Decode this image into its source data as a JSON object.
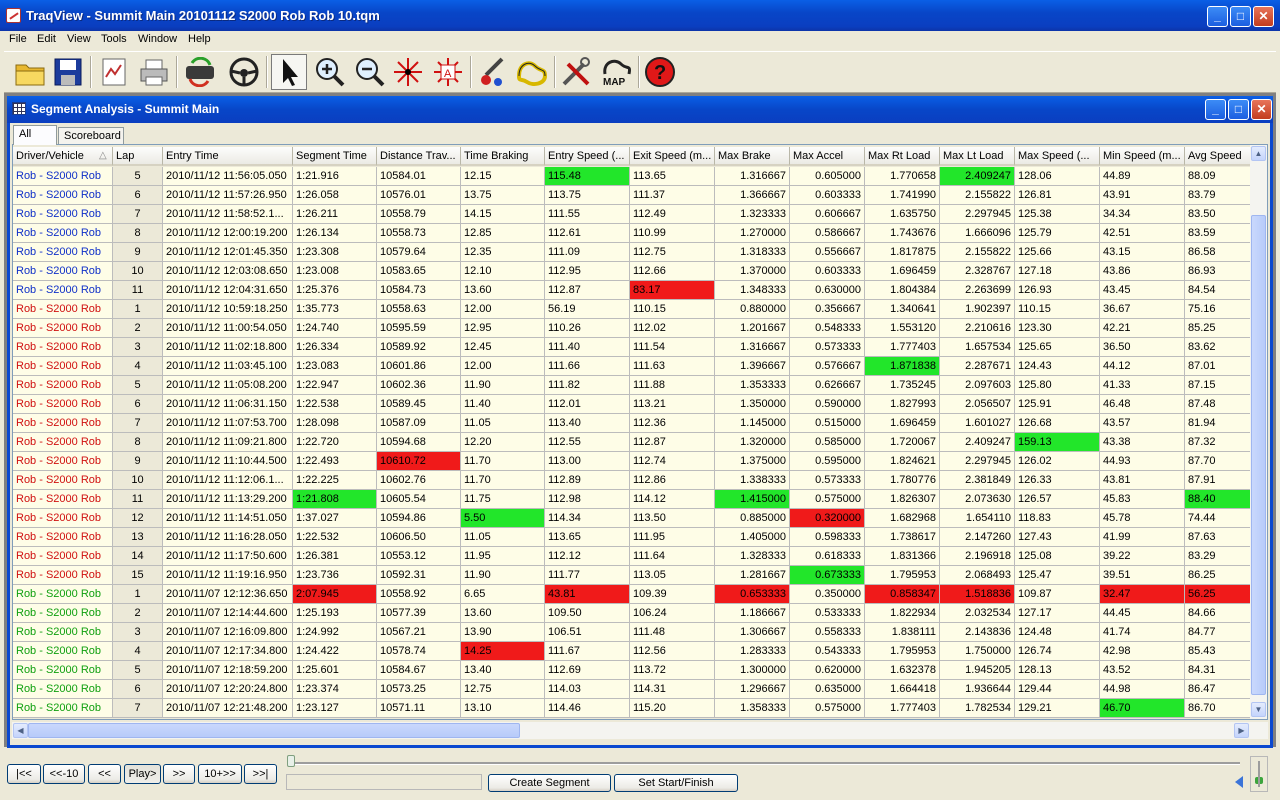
{
  "window": {
    "title": "TraqView - Summit Main 20101112 S2000 Rob Rob 10.tqm"
  },
  "menu": [
    "File",
    "Edit",
    "View",
    "Tools",
    "Window",
    "Help"
  ],
  "toolbar_icons": [
    "open-folder-icon",
    "save-icon",
    "report-icon",
    "print-icon",
    "sync-icon",
    "steering-wheel-icon",
    "pointer-icon",
    "zoom-in-icon",
    "zoom-out-icon",
    "crosshair-icon",
    "target-icon",
    "paint-icon",
    "track-icon",
    "tools-icon",
    "map-icon",
    "help-icon"
  ],
  "toolbar_map_label": "MAP",
  "toolbar_help_label": "?",
  "child": {
    "title": "Segment Analysis - Summit Main"
  },
  "tabs": [
    "All",
    "Scoreboard"
  ],
  "columns": [
    "Driver/Vehicle",
    "Lap",
    "Entry Time",
    "Segment Time",
    "Distance Trav...",
    "Time Braking",
    "Entry Speed (...",
    "Exit Speed (m...",
    "Max Brake",
    "Max Accel",
    "Max Rt Load",
    "Max Lt Load",
    "Max Speed (...",
    "Min Speed (m...",
    "Avg Speed"
  ],
  "colors": {
    "blue_driver": "#1030c8",
    "red_driver": "#d01010",
    "green_driver": "#10a010",
    "highlight_green": "#22e62a",
    "highlight_red": "#f01a1a"
  },
  "rows": [
    {
      "g": "blue",
      "d": [
        "Rob - S2000 Rob",
        "5",
        "2010/11/12 11:56:05.050",
        "1:21.916",
        "10584.01",
        "12.15",
        "115.48",
        "113.65",
        "1.316667",
        "0.605000",
        "1.770658",
        "2.409247",
        "128.06",
        "44.89",
        "88.09"
      ],
      "hl": {
        "6": "green",
        "11": "green"
      }
    },
    {
      "g": "blue",
      "d": [
        "Rob - S2000 Rob",
        "6",
        "2010/11/12 11:57:26.950",
        "1:26.058",
        "10576.01",
        "13.75",
        "113.75",
        "111.37",
        "1.366667",
        "0.603333",
        "1.741990",
        "2.155822",
        "126.81",
        "43.91",
        "83.79"
      ],
      "hl": {}
    },
    {
      "g": "blue",
      "d": [
        "Rob - S2000 Rob",
        "7",
        "2010/11/12 11:58:52.1...",
        "1:26.211",
        "10558.79",
        "14.15",
        "111.55",
        "112.49",
        "1.323333",
        "0.606667",
        "1.635750",
        "2.297945",
        "125.38",
        "34.34",
        "83.50"
      ],
      "hl": {}
    },
    {
      "g": "blue",
      "d": [
        "Rob - S2000 Rob",
        "8",
        "2010/11/12 12:00:19.200",
        "1:26.134",
        "10558.73",
        "12.85",
        "112.61",
        "110.99",
        "1.270000",
        "0.586667",
        "1.743676",
        "1.666096",
        "125.79",
        "42.51",
        "83.59"
      ],
      "hl": {}
    },
    {
      "g": "blue",
      "d": [
        "Rob - S2000 Rob",
        "9",
        "2010/11/12 12:01:45.350",
        "1:23.308",
        "10579.64",
        "12.35",
        "111.09",
        "112.75",
        "1.318333",
        "0.556667",
        "1.817875",
        "2.155822",
        "125.66",
        "43.15",
        "86.58"
      ],
      "hl": {}
    },
    {
      "g": "blue",
      "d": [
        "Rob - S2000 Rob",
        "10",
        "2010/11/12 12:03:08.650",
        "1:23.008",
        "10583.65",
        "12.10",
        "112.95",
        "112.66",
        "1.370000",
        "0.603333",
        "1.696459",
        "2.328767",
        "127.18",
        "43.86",
        "86.93"
      ],
      "hl": {}
    },
    {
      "g": "blue",
      "d": [
        "Rob - S2000 Rob",
        "11",
        "2010/11/12 12:04:31.650",
        "1:25.376",
        "10584.73",
        "13.60",
        "112.87",
        "83.17",
        "1.348333",
        "0.630000",
        "1.804384",
        "2.263699",
        "126.93",
        "43.45",
        "84.54"
      ],
      "hl": {
        "7": "red"
      }
    },
    {
      "g": "red",
      "d": [
        "Rob - S2000 Rob",
        "1",
        "2010/11/12 10:59:18.250",
        "1:35.773",
        "10558.63",
        "12.00",
        "56.19",
        "110.15",
        "0.880000",
        "0.356667",
        "1.340641",
        "1.902397",
        "110.15",
        "36.67",
        "75.16"
      ],
      "hl": {}
    },
    {
      "g": "red",
      "d": [
        "Rob - S2000 Rob",
        "2",
        "2010/11/12 11:00:54.050",
        "1:24.740",
        "10595.59",
        "12.95",
        "110.26",
        "112.02",
        "1.201667",
        "0.548333",
        "1.553120",
        "2.210616",
        "123.30",
        "42.21",
        "85.25"
      ],
      "hl": {}
    },
    {
      "g": "red",
      "d": [
        "Rob - S2000 Rob",
        "3",
        "2010/11/12 11:02:18.800",
        "1:26.334",
        "10589.92",
        "12.45",
        "111.40",
        "111.54",
        "1.316667",
        "0.573333",
        "1.777403",
        "1.657534",
        "125.65",
        "36.50",
        "83.62"
      ],
      "hl": {}
    },
    {
      "g": "red",
      "d": [
        "Rob - S2000 Rob",
        "4",
        "2010/11/12 11:03:45.100",
        "1:23.083",
        "10601.86",
        "12.00",
        "111.66",
        "111.63",
        "1.396667",
        "0.576667",
        "1.871838",
        "2.287671",
        "124.43",
        "44.12",
        "87.01"
      ],
      "hl": {
        "10": "green"
      }
    },
    {
      "g": "red",
      "d": [
        "Rob - S2000 Rob",
        "5",
        "2010/11/12 11:05:08.200",
        "1:22.947",
        "10602.36",
        "11.90",
        "111.82",
        "111.88",
        "1.353333",
        "0.626667",
        "1.735245",
        "2.097603",
        "125.80",
        "41.33",
        "87.15"
      ],
      "hl": {}
    },
    {
      "g": "red",
      "d": [
        "Rob - S2000 Rob",
        "6",
        "2010/11/12 11:06:31.150",
        "1:22.538",
        "10589.45",
        "11.40",
        "112.01",
        "113.21",
        "1.350000",
        "0.590000",
        "1.827993",
        "2.056507",
        "125.91",
        "46.48",
        "87.48"
      ],
      "hl": {}
    },
    {
      "g": "red",
      "d": [
        "Rob - S2000 Rob",
        "7",
        "2010/11/12 11:07:53.700",
        "1:28.098",
        "10587.09",
        "11.05",
        "113.40",
        "112.36",
        "1.145000",
        "0.515000",
        "1.696459",
        "1.601027",
        "126.68",
        "43.57",
        "81.94"
      ],
      "hl": {}
    },
    {
      "g": "red",
      "d": [
        "Rob - S2000 Rob",
        "8",
        "2010/11/12 11:09:21.800",
        "1:22.720",
        "10594.68",
        "12.20",
        "112.55",
        "112.87",
        "1.320000",
        "0.585000",
        "1.720067",
        "2.409247",
        "159.13",
        "43.38",
        "87.32"
      ],
      "hl": {
        "12": "green"
      }
    },
    {
      "g": "red",
      "d": [
        "Rob - S2000 Rob",
        "9",
        "2010/11/12 11:10:44.500",
        "1:22.493",
        "10610.72",
        "11.70",
        "113.00",
        "112.74",
        "1.375000",
        "0.595000",
        "1.824621",
        "2.297945",
        "126.02",
        "44.93",
        "87.70"
      ],
      "hl": {
        "4": "red"
      }
    },
    {
      "g": "red",
      "d": [
        "Rob - S2000 Rob",
        "10",
        "2010/11/12 11:12:06.1...",
        "1:22.225",
        "10602.76",
        "11.70",
        "112.89",
        "112.86",
        "1.338333",
        "0.573333",
        "1.780776",
        "2.381849",
        "126.33",
        "43.81",
        "87.91"
      ],
      "hl": {}
    },
    {
      "g": "red",
      "d": [
        "Rob - S2000 Rob",
        "11",
        "2010/11/12 11:13:29.200",
        "1:21.808",
        "10605.54",
        "11.75",
        "112.98",
        "114.12",
        "1.415000",
        "0.575000",
        "1.826307",
        "2.073630",
        "126.57",
        "45.83",
        "88.40"
      ],
      "hl": {
        "3": "green",
        "8": "green",
        "14": "green"
      }
    },
    {
      "g": "red",
      "d": [
        "Rob - S2000 Rob",
        "12",
        "2010/11/12 11:14:51.050",
        "1:37.027",
        "10594.86",
        "5.50",
        "114.34",
        "113.50",
        "0.885000",
        "0.320000",
        "1.682968",
        "1.654110",
        "118.83",
        "45.78",
        "74.44"
      ],
      "hl": {
        "5": "green",
        "9": "red"
      }
    },
    {
      "g": "red",
      "d": [
        "Rob - S2000 Rob",
        "13",
        "2010/11/12 11:16:28.050",
        "1:22.532",
        "10606.50",
        "11.05",
        "113.65",
        "111.95",
        "1.405000",
        "0.598333",
        "1.738617",
        "2.147260",
        "127.43",
        "41.99",
        "87.63"
      ],
      "hl": {}
    },
    {
      "g": "red",
      "d": [
        "Rob - S2000 Rob",
        "14",
        "2010/11/12 11:17:50.600",
        "1:26.381",
        "10553.12",
        "11.95",
        "112.12",
        "111.64",
        "1.328333",
        "0.618333",
        "1.831366",
        "2.196918",
        "125.08",
        "39.22",
        "83.29"
      ],
      "hl": {}
    },
    {
      "g": "red",
      "d": [
        "Rob - S2000 Rob",
        "15",
        "2010/11/12 11:19:16.950",
        "1:23.736",
        "10592.31",
        "11.90",
        "111.77",
        "113.05",
        "1.281667",
        "0.673333",
        "1.795953",
        "2.068493",
        "125.47",
        "39.51",
        "86.25"
      ],
      "hl": {
        "9": "green"
      }
    },
    {
      "g": "green",
      "d": [
        "Rob - S2000 Rob",
        "1",
        "2010/11/07 12:12:36.650",
        "2:07.945",
        "10558.92",
        "6.65",
        "43.81",
        "109.39",
        "0.653333",
        "0.350000",
        "0.858347",
        "1.518836",
        "109.87",
        "32.47",
        "56.25"
      ],
      "hl": {
        "3": "red",
        "6": "red",
        "8": "red",
        "10": "red",
        "11": "red",
        "13": "red",
        "14": "red"
      }
    },
    {
      "g": "green",
      "d": [
        "Rob - S2000 Rob",
        "2",
        "2010/11/07 12:14:44.600",
        "1:25.193",
        "10577.39",
        "13.60",
        "109.50",
        "106.24",
        "1.186667",
        "0.533333",
        "1.822934",
        "2.032534",
        "127.17",
        "44.45",
        "84.66"
      ],
      "hl": {}
    },
    {
      "g": "green",
      "d": [
        "Rob - S2000 Rob",
        "3",
        "2010/11/07 12:16:09.800",
        "1:24.992",
        "10567.21",
        "13.90",
        "106.51",
        "111.48",
        "1.306667",
        "0.558333",
        "1.838111",
        "2.143836",
        "124.48",
        "41.74",
        "84.77"
      ],
      "hl": {}
    },
    {
      "g": "green",
      "d": [
        "Rob - S2000 Rob",
        "4",
        "2010/11/07 12:17:34.800",
        "1:24.422",
        "10578.74",
        "14.25",
        "111.67",
        "112.56",
        "1.283333",
        "0.543333",
        "1.795953",
        "1.750000",
        "126.74",
        "42.98",
        "85.43"
      ],
      "hl": {
        "5": "red"
      }
    },
    {
      "g": "green",
      "d": [
        "Rob - S2000 Rob",
        "5",
        "2010/11/07 12:18:59.200",
        "1:25.601",
        "10584.67",
        "13.40",
        "112.69",
        "113.72",
        "1.300000",
        "0.620000",
        "1.632378",
        "1.945205",
        "128.13",
        "43.52",
        "84.31"
      ],
      "hl": {}
    },
    {
      "g": "green",
      "d": [
        "Rob - S2000 Rob",
        "6",
        "2010/11/07 12:20:24.800",
        "1:23.374",
        "10573.25",
        "12.75",
        "114.03",
        "114.31",
        "1.296667",
        "0.635000",
        "1.664418",
        "1.936644",
        "129.44",
        "44.98",
        "86.47"
      ],
      "hl": {}
    },
    {
      "g": "green",
      "d": [
        "Rob - S2000 Rob",
        "7",
        "2010/11/07 12:21:48.200",
        "1:23.127",
        "10571.11",
        "13.10",
        "114.46",
        "115.20",
        "1.358333",
        "0.575000",
        "1.777403",
        "1.782534",
        "129.21",
        "46.70",
        "86.70"
      ],
      "hl": {
        "13": "green"
      }
    }
  ],
  "nav": [
    "|<<",
    "<<-10",
    "<<",
    "Play>",
    ">>",
    "10+>>",
    ">>|"
  ],
  "buttons": {
    "create_segment": "Create Segment",
    "set_start_finish": "Set Start/Finish"
  }
}
